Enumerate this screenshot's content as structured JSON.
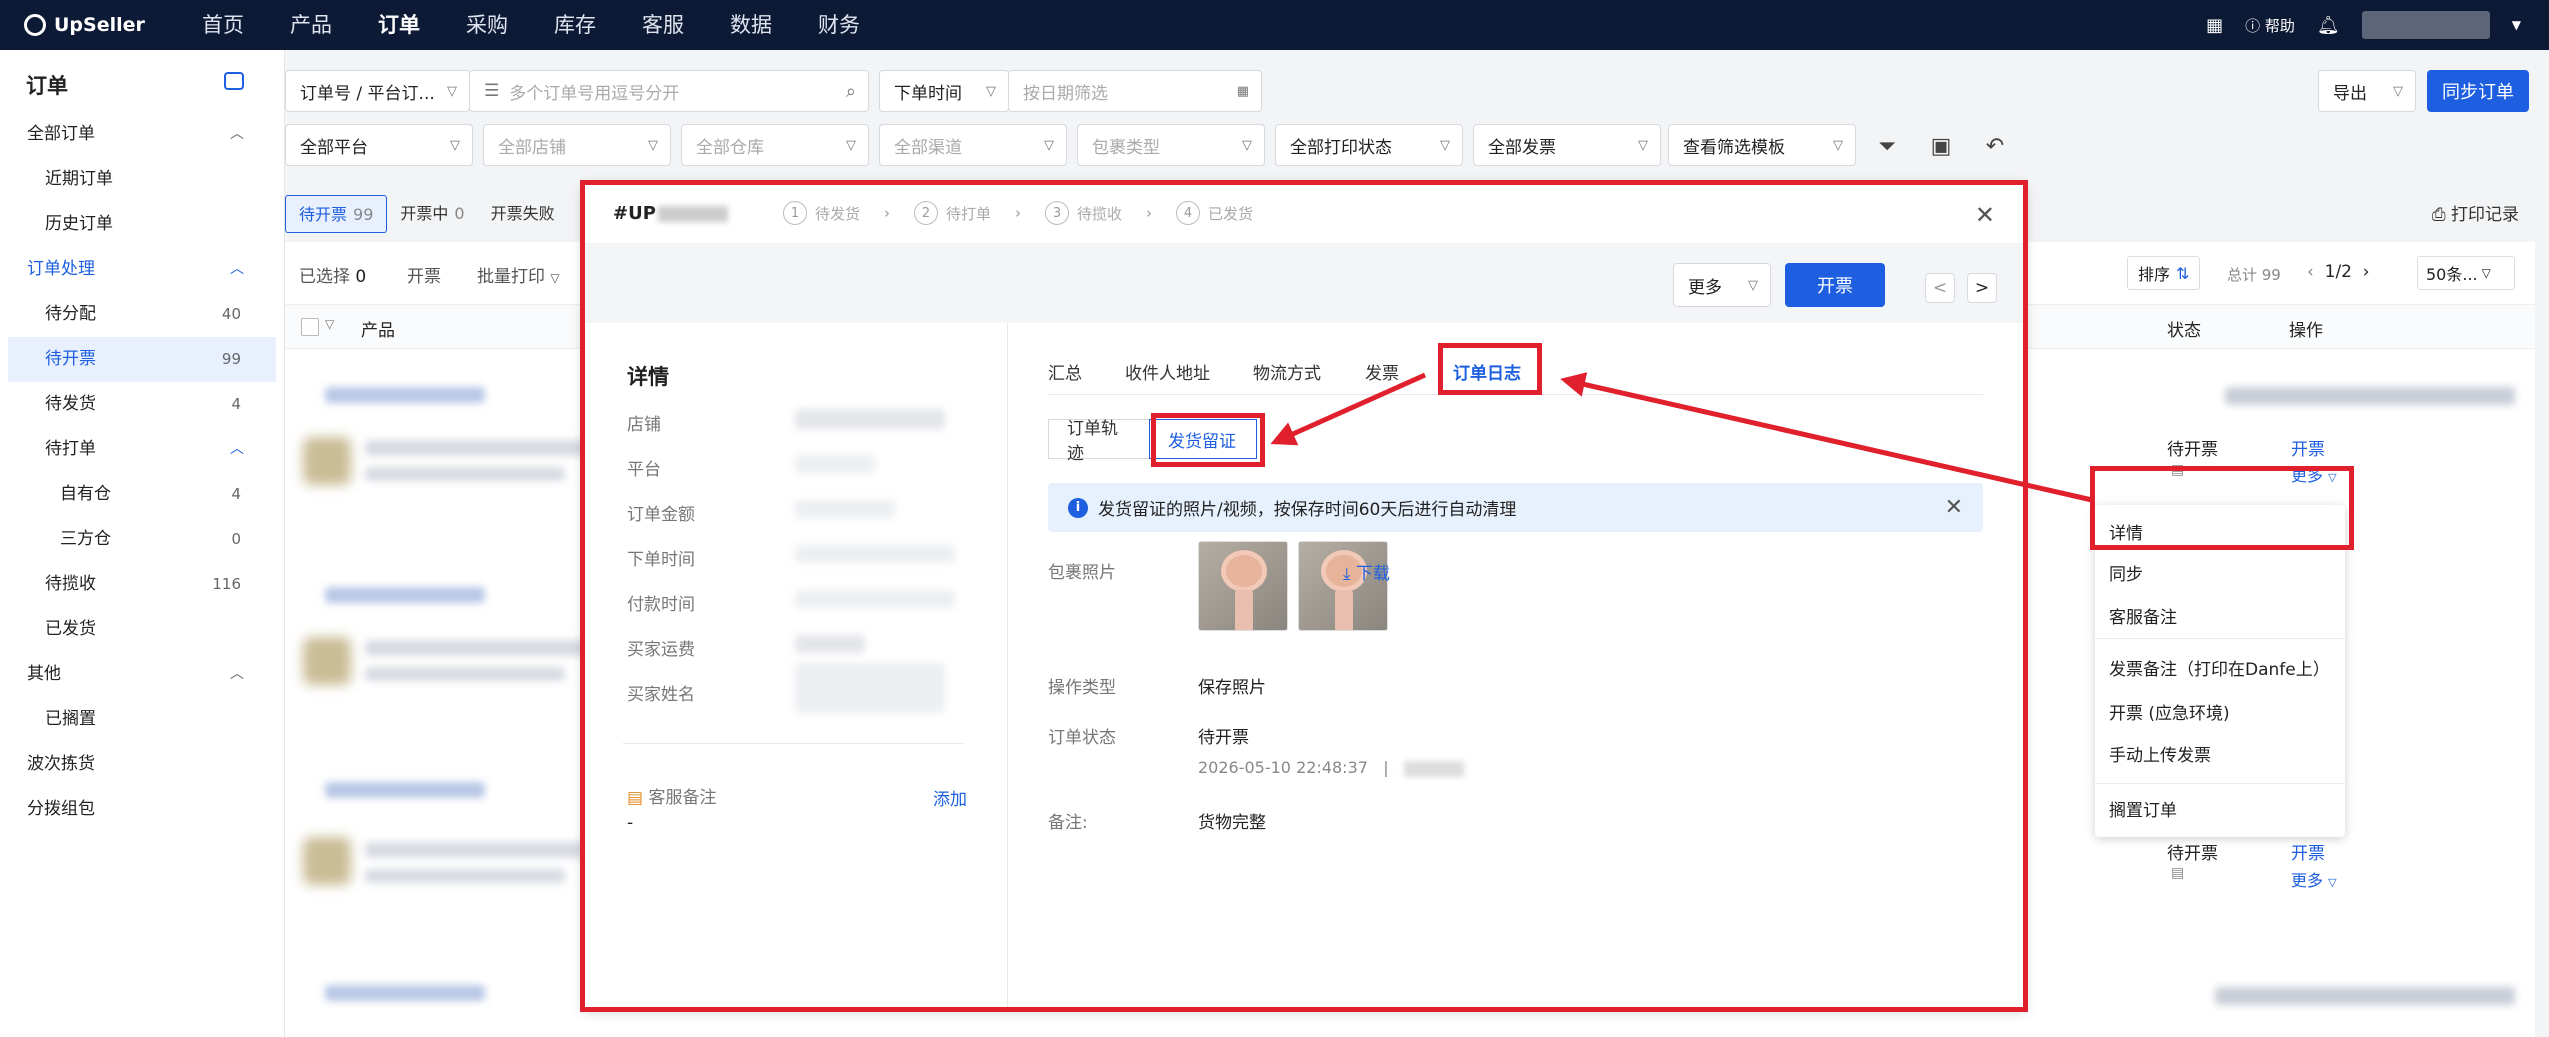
{
  "topbar": {
    "logo": "UpSeller",
    "nav": [
      "首页",
      "产品",
      "订单",
      "采购",
      "库存",
      "客服",
      "数据",
      "财务"
    ],
    "help": "帮助"
  },
  "sidebar": {
    "title": "订单",
    "items": [
      {
        "label": "全部订单"
      },
      {
        "label": "近期订单"
      },
      {
        "label": "历史订单"
      },
      {
        "label": "订单处理"
      },
      {
        "label": "待分配",
        "count": "40"
      },
      {
        "label": "待开票",
        "count": "99"
      },
      {
        "label": "待发货",
        "count": "4"
      },
      {
        "label": "待打单"
      },
      {
        "label": "自有仓",
        "count": "4"
      },
      {
        "label": "三方仓",
        "count": "0"
      },
      {
        "label": "待揽收",
        "count": "116"
      },
      {
        "label": "已发货"
      },
      {
        "label": "其他"
      },
      {
        "label": "已搁置"
      },
      {
        "label": "波次拣货"
      },
      {
        "label": "分拨组包"
      }
    ]
  },
  "filters": {
    "search_type": "订单号 / 平台订...",
    "search_placeholder": "多个订单号用逗号分开",
    "time_type": "下单时间",
    "date_placeholder": "按日期筛选",
    "platform": "全部平台",
    "shop": "全部店铺",
    "warehouse": "全部仓库",
    "channel": "全部渠道",
    "package_type": "包裹类型",
    "print_status": "全部打印状态",
    "invoice": "全部发票",
    "template": "查看筛选模板",
    "export": "导出",
    "sync": "同步订单",
    "print_log": "打印记录"
  },
  "tabs": [
    {
      "label": "待开票",
      "count": "99"
    },
    {
      "label": "开票中",
      "count": "0"
    },
    {
      "label": "开票失败"
    }
  ],
  "toolbar": {
    "selected": "已选择",
    "selected_count": "0",
    "invoice": "开票",
    "batch_print": "批量打印",
    "sort": "排序",
    "total": "总计 99",
    "page": "1/2",
    "page_size": "50条..."
  },
  "table": {
    "col_product": "产品",
    "col_status": "状态",
    "col_action": "操作",
    "rows": [
      {
        "status": "待开票",
        "action": "开票",
        "more": "更多"
      },
      {
        "status": "待开票",
        "action": "开票",
        "more": "更多"
      }
    ]
  },
  "modal": {
    "order_no": "#UP",
    "steps": [
      {
        "num": "1",
        "label": "待发货"
      },
      {
        "num": "2",
        "label": "待打单"
      },
      {
        "num": "3",
        "label": "待揽收"
      },
      {
        "num": "4",
        "label": "已发货"
      }
    ],
    "more": "更多",
    "invoice": "开票",
    "prev": "<",
    "next": ">",
    "details_title": "详情",
    "details_fields": [
      "店铺",
      "平台",
      "订单金额",
      "下单时间",
      "付款时间",
      "买家运费",
      "买家姓名"
    ],
    "cs_note": "客服备注",
    "add": "添加",
    "cs_value": "-",
    "tabs": [
      "汇总",
      "收件人地址",
      "物流方式",
      "发票",
      "订单日志"
    ],
    "subtabs": [
      "订单轨迹",
      "发货留证"
    ],
    "info": "发货留证的照片/视频，按保存时间60天后进行自动清理",
    "package_photo_label": "包裹照片",
    "download": "下载",
    "op_type_label": "操作类型",
    "op_type_value": "保存照片",
    "order_status_label": "订单状态",
    "order_status_value": "待开票",
    "timestamp": "2026-05-10 22:48:37",
    "note_label": "备注:",
    "note_value": "货物完整"
  },
  "dropdown": {
    "items": [
      "详情",
      "同步",
      "客服备注",
      "发票备注（打印在Danfe上）",
      "开票 (应急环境)",
      "手动上传发票",
      "搁置订单"
    ]
  },
  "colors": {
    "accent": "#1d5fe0",
    "annotation": "#e0202c",
    "topbar": "#0d1a36"
  }
}
